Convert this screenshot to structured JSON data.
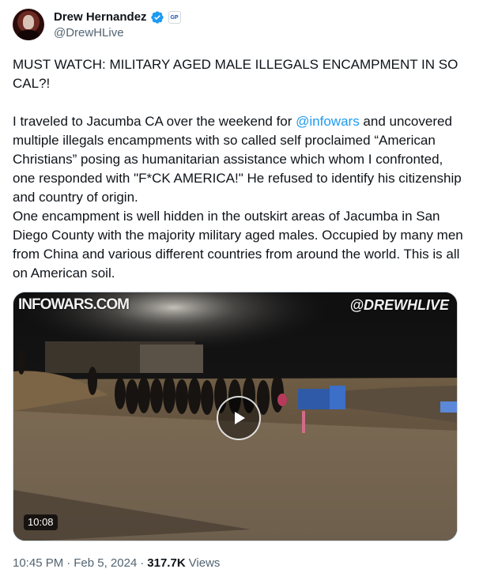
{
  "author": {
    "display_name": "Drew Hernandez",
    "handle": "@DrewHLive",
    "verified": true,
    "affiliate_badge": "GP"
  },
  "tweet": {
    "headline": "MUST WATCH: MILITARY AGED MALE ILLEGALS ENCAMPMENT IN SO CAL?!",
    "para1_before": "I traveled to Jacumba CA over the weekend for ",
    "mention": "@infowars",
    "para1_after": " and uncovered multiple illegals encampments with so called self proclaimed “American Christians” posing as humanitarian assistance which whom I confronted, one responded with \"F*CK AMERICA!\" He refused to identify his citizenship and country of origin.",
    "para2": "One encampment is well hidden in the outskirt areas of Jacumba in San Diego County with the majority military aged males. Occupied by many men from China and various different countries from around the world. This is all on American soil."
  },
  "media": {
    "type": "video",
    "watermark_left": "INFOWARS.COM",
    "watermark_right": "@DREWHLIVE",
    "duration": "10:08",
    "play_icon": "play-icon"
  },
  "meta": {
    "time": "10:45 PM",
    "separator": "·",
    "date": "Feb 5, 2024",
    "views_count": "317.7K",
    "views_label": "Views"
  },
  "colors": {
    "link": "#1d9bf0",
    "verified": "#1d9bf0",
    "secondary_text": "#536471"
  }
}
